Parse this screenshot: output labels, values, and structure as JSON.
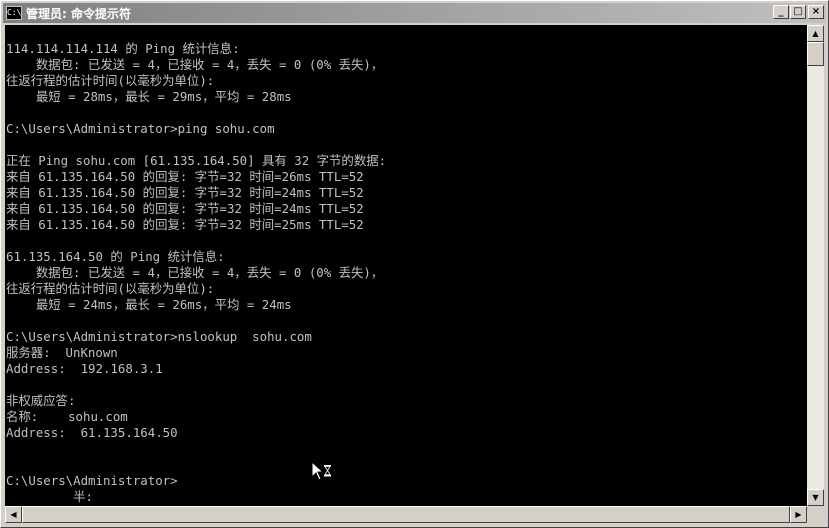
{
  "window": {
    "title": "管理员: 命令提示符",
    "icon": "console-app-icon",
    "buttons": {
      "minimize": "_",
      "maximize": "□",
      "close": "×"
    }
  },
  "console": {
    "lines": [
      "",
      "114.114.114.114 的 Ping 统计信息:",
      "    数据包: 已发送 = 4，已接收 = 4，丢失 = 0 (0% 丢失)，",
      "往返行程的估计时间(以毫秒为单位):",
      "    最短 = 28ms，最长 = 29ms，平均 = 28ms",
      "",
      "C:\\Users\\Administrator>ping sohu.com",
      "",
      "正在 Ping sohu.com [61.135.164.50] 具有 32 字节的数据:",
      "来自 61.135.164.50 的回复: 字节=32 时间=26ms TTL=52",
      "来自 61.135.164.50 的回复: 字节=32 时间=24ms TTL=52",
      "来自 61.135.164.50 的回复: 字节=32 时间=24ms TTL=52",
      "来自 61.135.164.50 的回复: 字节=32 时间=25ms TTL=52",
      "",
      "61.135.164.50 的 Ping 统计信息:",
      "    数据包: 已发送 = 4，已接收 = 4，丢失 = 0 (0% 丢失)，",
      "往返行程的估计时间(以毫秒为单位):",
      "    最短 = 24ms，最长 = 26ms，平均 = 24ms",
      "",
      "C:\\Users\\Administrator>nslookup  sohu.com",
      "服务器:  UnKnown",
      "Address:  192.168.3.1",
      "",
      "非权威应答:",
      "名称:    sohu.com",
      "Address:  61.135.164.50",
      "",
      "",
      "C:\\Users\\Administrator>",
      "         半:"
    ]
  },
  "scrollbars": {
    "up_arrow": "▲",
    "down_arrow": "▼",
    "left_arrow": "◀",
    "right_arrow": "▶"
  },
  "cursor": "busy-pointer-icon",
  "colors": {
    "console_bg": "#000000",
    "console_fg": "#c0c0c0",
    "chrome": "#d4d0c8"
  }
}
